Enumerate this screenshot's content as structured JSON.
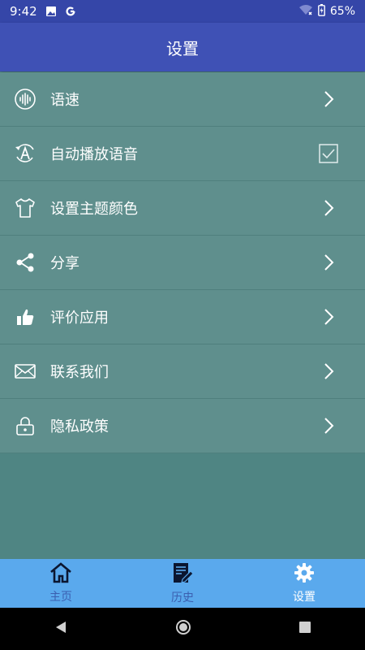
{
  "status_bar": {
    "time": "9:42",
    "battery": "65%",
    "icons": [
      "image-icon",
      "google-icon",
      "wifi-icon",
      "battery-icon"
    ]
  },
  "app_bar": {
    "title": "设置"
  },
  "settings": {
    "items": [
      {
        "label": "语速",
        "icon": "voice-wave-icon",
        "trailing": "chevron-right-icon"
      },
      {
        "label": "自动播放语音",
        "icon": "auto-play-icon",
        "trailing": "checkbox",
        "checked": true
      },
      {
        "label": "设置主题颜色",
        "icon": "shirt-icon",
        "trailing": "chevron-right-icon"
      },
      {
        "label": "分享",
        "icon": "share-icon",
        "trailing": "chevron-right-icon"
      },
      {
        "label": "评价应用",
        "icon": "thumbs-up-icon",
        "trailing": "chevron-right-icon"
      },
      {
        "label": "联系我们",
        "icon": "mail-icon",
        "trailing": "chevron-right-icon"
      },
      {
        "label": "隐私政策",
        "icon": "lock-icon",
        "trailing": "chevron-right-icon"
      }
    ]
  },
  "bottom_nav": {
    "tabs": [
      {
        "label": "主页",
        "icon": "home-icon",
        "active": false
      },
      {
        "label": "历史",
        "icon": "history-icon",
        "active": false
      },
      {
        "label": "设置",
        "icon": "gear-icon",
        "active": true
      }
    ]
  },
  "colors": {
    "status_bar": "#3546a8",
    "app_bar": "#3f51b5",
    "list_row": "#5f8f8d",
    "background": "#4f8583",
    "bottom_nav": "#5aa9ed",
    "tab_inactive": "#3b5fb0",
    "tab_active": "#ffffff"
  }
}
